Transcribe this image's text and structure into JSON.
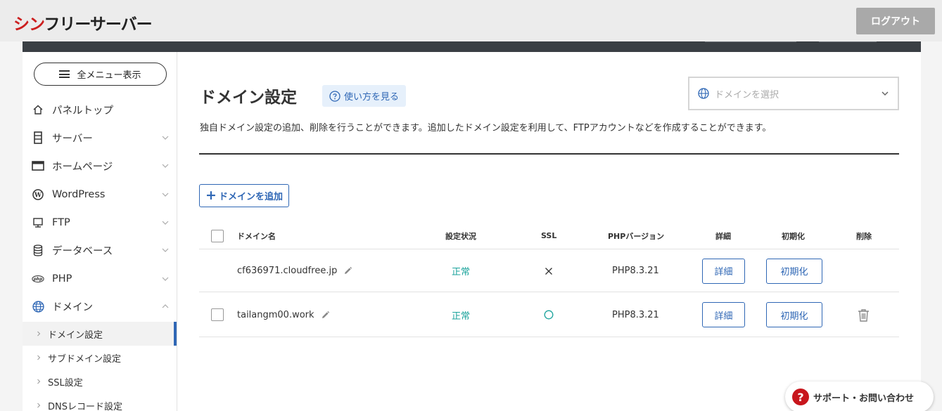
{
  "app": {
    "logo_red": "シン",
    "logo_rest": "フリーサーバー",
    "logout_label": "ログアウト"
  },
  "sidebar": {
    "menu_button": "全メニュー表示",
    "items": [
      {
        "label": "パネルトップ",
        "icon": "home-icon"
      },
      {
        "label": "サーバー",
        "icon": "server-icon"
      },
      {
        "label": "ホームページ",
        "icon": "browser-icon"
      },
      {
        "label": "WordPress",
        "icon": "wordpress-icon"
      },
      {
        "label": "FTP",
        "icon": "monitor-icon"
      },
      {
        "label": "データベース",
        "icon": "database-icon"
      },
      {
        "label": "PHP",
        "icon": "php-icon"
      },
      {
        "label": "ドメイン",
        "icon": "globe-icon"
      }
    ],
    "sub_items": [
      {
        "label": "ドメイン設定",
        "active": true
      },
      {
        "label": "サブドメイン設定",
        "active": false
      },
      {
        "label": "SSL設定",
        "active": false
      },
      {
        "label": "DNSレコード設定",
        "active": false
      }
    ]
  },
  "main": {
    "title": "ドメイン設定",
    "howto_label": "使い方を見る",
    "domain_select_placeholder": "ドメインを選択",
    "description": "独自ドメイン設定の追加、削除を行うことができます。追加したドメイン設定を利用して、FTPアカウントなどを作成することができます。",
    "add_button": "ドメインを追加"
  },
  "table": {
    "headers": {
      "domain": "ドメイン名",
      "status": "設定状況",
      "ssl": "SSL",
      "php": "PHPバージョン",
      "detail": "詳細",
      "init": "初期化",
      "delete": "削除"
    },
    "rows": [
      {
        "domain": "cf636971.cloudfree.jp",
        "status": "正常",
        "ssl": "×",
        "php": "PHP8.3.21",
        "detail": "詳細",
        "init": "初期化",
        "has_checkbox": false,
        "has_delete": false
      },
      {
        "domain": "tailangm00.work",
        "status": "正常",
        "ssl": "○",
        "php": "PHP8.3.21",
        "detail": "詳細",
        "init": "初期化",
        "has_checkbox": true,
        "has_delete": true
      }
    ]
  },
  "support": {
    "label": "サポート・お問い合わせ"
  },
  "colors": {
    "accent": "#2f67b5",
    "status_ok": "#1ba39c",
    "logo_red": "#cc1f1f"
  }
}
